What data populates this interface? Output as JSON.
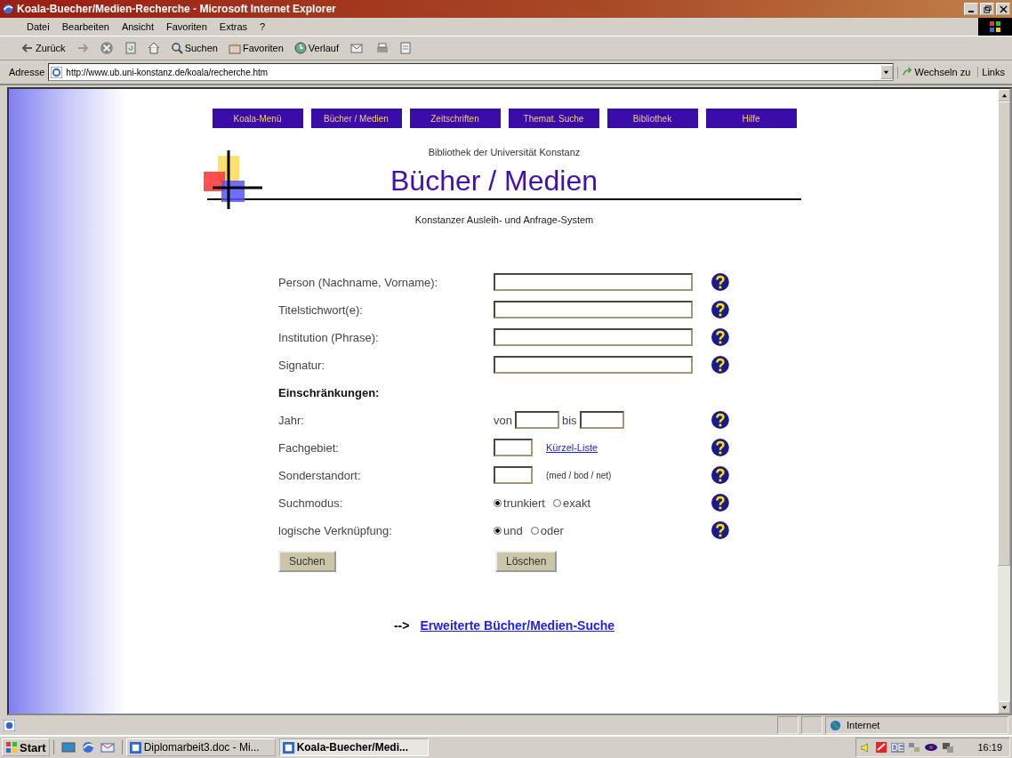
{
  "window": {
    "title": "Koala-Buecher/Medien-Recherche - Microsoft Internet Explorer"
  },
  "menu": [
    "Datei",
    "Bearbeiten",
    "Ansicht",
    "Favoriten",
    "Extras",
    "?"
  ],
  "toolbar": [
    {
      "kind": "back",
      "label": "Zurück"
    },
    {
      "kind": "forward"
    },
    {
      "kind": "stop"
    },
    {
      "kind": "refresh"
    },
    {
      "kind": "home"
    },
    {
      "kind": "search",
      "label": "Suchen"
    },
    {
      "kind": "favorites",
      "label": "Favoriten"
    },
    {
      "kind": "history",
      "label": "Verlauf"
    },
    {
      "kind": "mail"
    },
    {
      "kind": "print"
    },
    {
      "kind": "edit"
    }
  ],
  "address": {
    "label": "Adresse",
    "value": "http://www.ub.uni-konstanz.de/koala/recherche.htm",
    "go": "Wechseln zu",
    "links": "Links"
  },
  "nav": [
    "Koala-Menü",
    "Bücher / Medien",
    "Zeitschriften",
    "Themat. Suche",
    "Bibliothek",
    "Hilfe"
  ],
  "header": {
    "institution": "Bibliothek der Universität Konstanz",
    "title": "Bücher / Medien",
    "subtitle": "Konstanzer Ausleih- und Anfrage-System"
  },
  "form": {
    "rows": [
      {
        "kind": "text",
        "label": "Person (Nachname, Vorname):"
      },
      {
        "kind": "text",
        "label": "Titelstichwort(e):"
      },
      {
        "kind": "text",
        "label": "Institution (Phrase):"
      },
      {
        "kind": "text",
        "label": "Signatur:"
      },
      {
        "kind": "heading",
        "label": "Einschränkungen:"
      },
      {
        "kind": "range",
        "label": "Jahr:",
        "from": "von",
        "to": "bis"
      },
      {
        "kind": "code",
        "label": "Fachgebiet:",
        "link": "Kürzel-Liste"
      },
      {
        "kind": "code",
        "label": "Sonderstandort:",
        "hint": "(med / bod / net)"
      },
      {
        "kind": "radio",
        "label": "Suchmodus:",
        "options": [
          {
            "label": "trunkiert",
            "selected": true
          },
          {
            "label": "exakt",
            "selected": false
          }
        ]
      },
      {
        "kind": "radio",
        "label": "logische Verknüpfung:",
        "options": [
          {
            "label": "und",
            "selected": true
          },
          {
            "label": "oder",
            "selected": false
          }
        ]
      }
    ],
    "buttons": [
      "Suchen",
      "Löschen"
    ]
  },
  "extended": {
    "arrow": "-->",
    "link": "Erweiterte Bücher/Medien-Suche"
  },
  "status_bar": {
    "zone": "Internet"
  },
  "taskbar": {
    "start": "Start",
    "tasks": [
      {
        "label": "Diplomarbeit3.doc - Mi...",
        "selected": false
      },
      {
        "label": "Koala-Buecher/Medi...",
        "selected": true
      }
    ],
    "lang": "DE",
    "clock": "16:19"
  }
}
